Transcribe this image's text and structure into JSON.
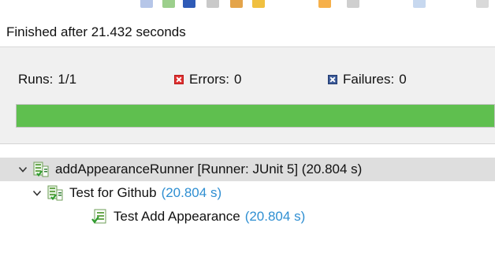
{
  "status": {
    "message": "Finished after 21.432 seconds"
  },
  "counters": {
    "runs_label": "Runs:",
    "runs_value": "1/1",
    "errors_label": "Errors:",
    "errors_value": "0",
    "failures_label": "Failures:",
    "failures_value": "0"
  },
  "progress": {
    "fraction": 1.0,
    "color": "#5fbf4f"
  },
  "tree": {
    "root": {
      "label": "addAppearanceRunner [Runner: JUnit 5] (20.804 s)",
      "icon": "test-suite-pass-icon",
      "expanded": true
    },
    "suite": {
      "label": "Test for Github",
      "time": "(20.804 s)",
      "icon": "test-suite-pass-icon",
      "expanded": true
    },
    "test": {
      "label": "Test Add Appearance",
      "time": "(20.804 s)",
      "icon": "test-pass-icon"
    }
  },
  "colors": {
    "error": "#e03030",
    "failure": "#3c5b99",
    "time": "#2f8fd2",
    "selection": "#dedede"
  }
}
